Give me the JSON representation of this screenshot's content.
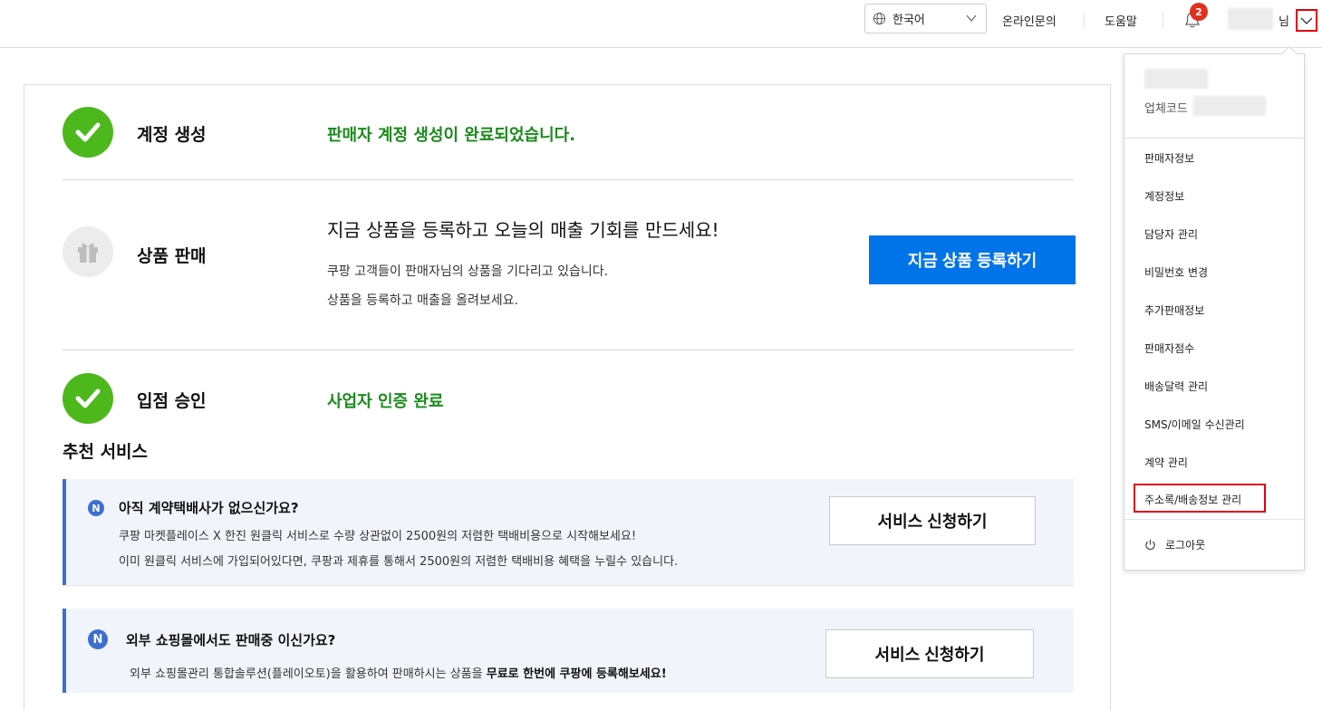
{
  "header": {
    "language": "한국어",
    "links": [
      "온라인문의",
      "도움말"
    ],
    "notification_count": "2",
    "user_suffix": "님"
  },
  "steps": [
    {
      "title": "계정 생성",
      "status": "판매자 계정 생성이 완료되었습니다."
    },
    {
      "title": "상품 판매",
      "headline": "지금 상품을 등록하고 오늘의 매출 기회를 만드세요!",
      "lines": [
        "쿠팡 고객들이 판매자님의 상품을 기다리고 있습니다.",
        "상품을 등록하고 매출을 올려보세요."
      ],
      "button": "지금 상품 등록하기"
    },
    {
      "title": "입점 승인",
      "status": "사업자 인증 완료"
    }
  ],
  "recommended": {
    "title": "추천 서비스",
    "services": [
      {
        "badge": "N",
        "title": "아직 계약택배사가 없으신가요?",
        "lines": [
          "쿠팡 마켓플레이스 X 한진 원클릭 서비스로 수량 상관없이 2500원의 저렴한 택배비용으로 시작해보세요!",
          "이미 원클릭 서비스에 가입되어있다면, 쿠팡과 제휴를 통해서 2500원의 저렴한 택배비용 혜택을 누릴수 있습니다."
        ],
        "button": "서비스 신청하기"
      },
      {
        "badge": "N",
        "title": "외부 쇼핑몰에서도 판매중 이신가요?",
        "desc_plain": "외부 쇼핑몰관리 통합솔루션(플레이오토)을 활용하여 판매하시는 상품을 ",
        "desc_bold": "무료로 한번에 쿠팡에 등록해보세요!",
        "button": "서비스 신청하기"
      }
    ]
  },
  "dropdown": {
    "code_label": "업체코드",
    "items": [
      "판매자정보",
      "계정정보",
      "담당자 관리",
      "비밀번호 변경",
      "추가판매정보",
      "판매자점수",
      "배송달력 관리",
      "SMS/이메일 수신관리",
      "계약 관리",
      "주소록/배송정보 관리"
    ],
    "logout": "로그아웃"
  },
  "colors": {
    "primary": "#0074e8",
    "success": "#4cb81c",
    "status_text": "#1b8a1b",
    "badge": "#e0301e",
    "highlight_box": "#e00012",
    "service_bg": "#f1f5fb",
    "service_accent": "#3c6fd0"
  }
}
